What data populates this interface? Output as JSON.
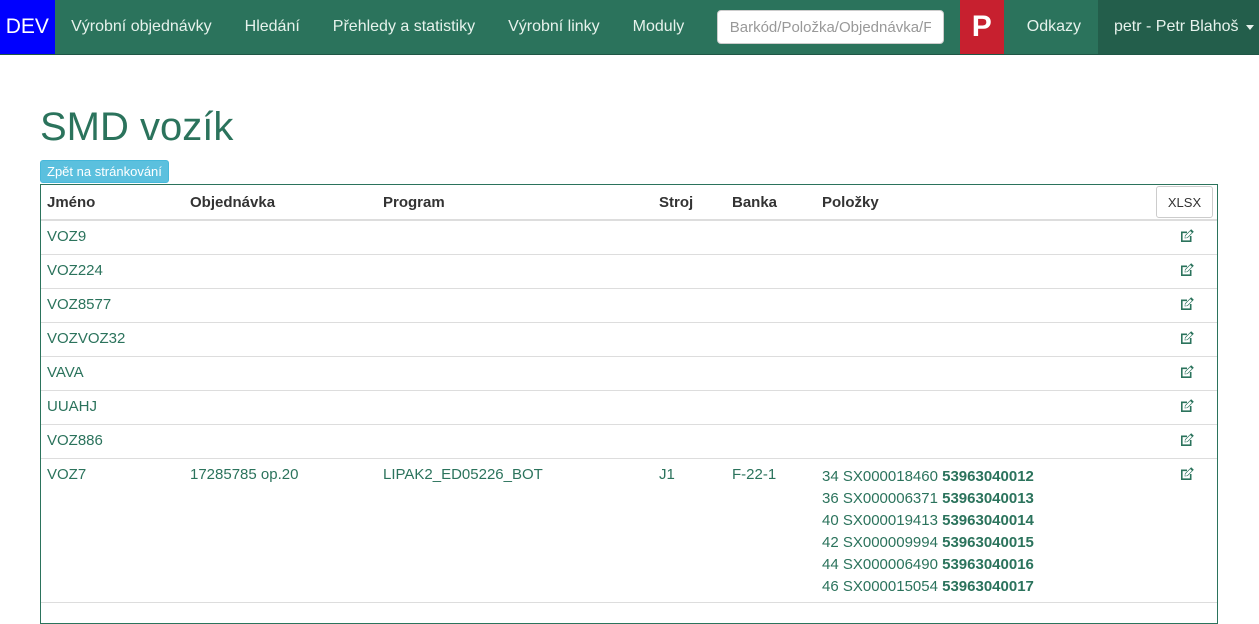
{
  "nav": {
    "env": "DEV",
    "items": [
      "Výrobní objednávky",
      "Hledání",
      "Přehledy a statistiky",
      "Výrobní linky",
      "Moduly"
    ],
    "search_placeholder": "Barkód/Položka/Objednávka/F",
    "p_label": "P",
    "links_label": "Odkazy",
    "user_label": "petr - Petr Blahoš"
  },
  "page": {
    "title": "SMD vozík",
    "back_label": "Zpět na stránkování"
  },
  "table": {
    "headers": [
      "Jméno",
      "Objednávka",
      "Program",
      "Stroj",
      "Banka",
      "Položky"
    ],
    "export_label": "XLSX",
    "rows": [
      {
        "name": "VOZ9"
      },
      {
        "name": "VOZ224"
      },
      {
        "name": "VOZ8577"
      },
      {
        "name": "VOZVOZ32"
      },
      {
        "name": "VAVA"
      },
      {
        "name": "UUAHJ"
      },
      {
        "name": "VOZ886"
      },
      {
        "name": "VOZ7",
        "order": "17285785 op.20",
        "program": "LIPAK2_ED05226_BOT",
        "stroj": "J1",
        "banka": "F-22-1",
        "items": [
          {
            "prefix": "34 SX000018460",
            "code": "53963040012"
          },
          {
            "prefix": "36 SX000006371",
            "code": "53963040013"
          },
          {
            "prefix": "40 SX000019413",
            "code": "53963040014"
          },
          {
            "prefix": "42 SX000009994",
            "code": "53963040015"
          },
          {
            "prefix": "44 SX000006490",
            "code": "53963040016"
          },
          {
            "prefix": "46 SX000015054",
            "code": "53963040017"
          }
        ]
      }
    ]
  },
  "colors": {
    "primary": "#2b735c",
    "env_badge": "#0000ff",
    "p_button": "#c7202f",
    "info_button": "#5bc0de"
  }
}
